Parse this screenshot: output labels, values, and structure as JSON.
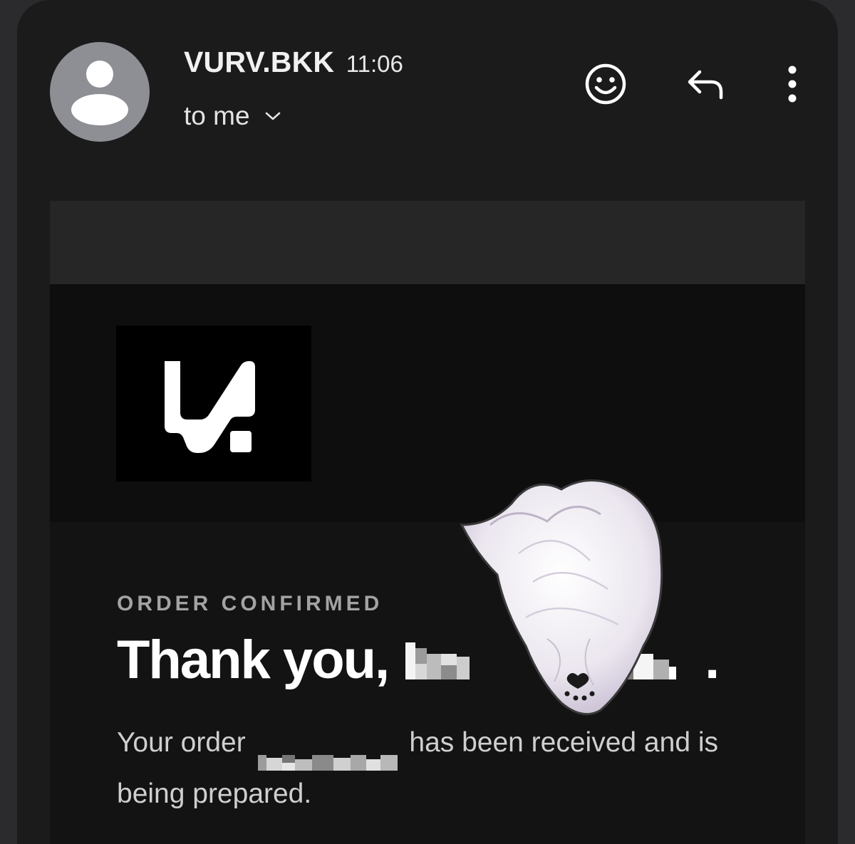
{
  "header": {
    "sender_name": "VURV.BKK",
    "time": "11:06",
    "recipient": "to me",
    "icons": {
      "avatar": "person-icon",
      "expand": "chevron-down-icon",
      "react": "emoji-icon",
      "reply": "reply-icon",
      "more": "more-vert-icon"
    }
  },
  "email": {
    "eyebrow": "ORDER CONFIRMED",
    "headline_prefix": "Thank you,",
    "headline_suffix": ".",
    "body_prefix": "Your order",
    "body_suffix": "has been received and is being prepared."
  },
  "colors": {
    "page_background": "#2b2b2d",
    "card_background": "#1b1b1c",
    "avatar": "#8d8f94",
    "headline": "#ffffff",
    "eyebrow": "#a3a3a3"
  }
}
